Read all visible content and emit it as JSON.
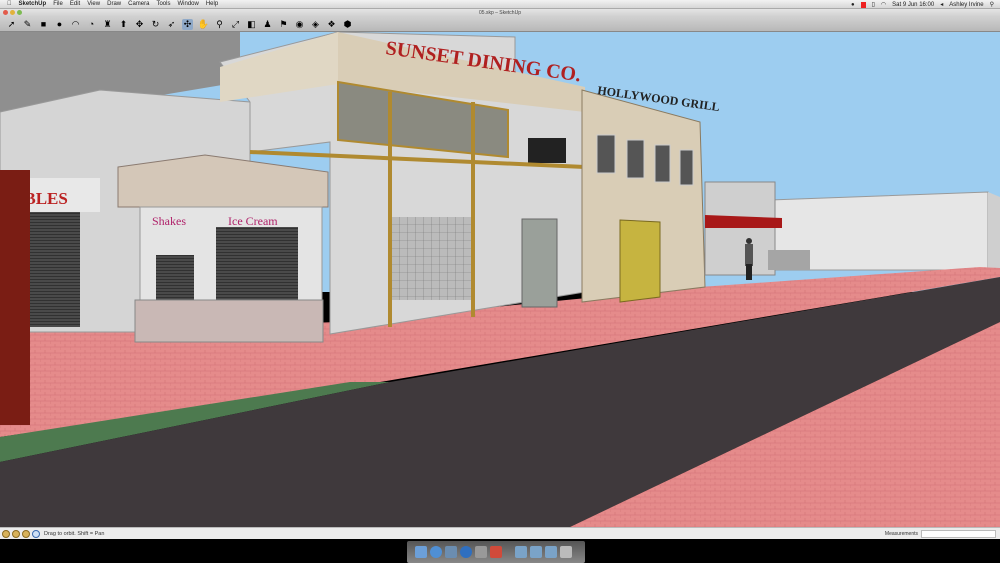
{
  "menubar": {
    "app": "SketchUp",
    "items": [
      "File",
      "Edit",
      "View",
      "Draw",
      "Camera",
      "Tools",
      "Window",
      "Help"
    ],
    "clock": "Sat 9 Jun  16:00",
    "user": "Ashley Irvine"
  },
  "window": {
    "title": "05.skp – SketchUp"
  },
  "toolbar": {
    "tools": [
      {
        "name": "select",
        "glyph": "➚"
      },
      {
        "name": "pencil",
        "glyph": "✎"
      },
      {
        "name": "rectangle",
        "glyph": "■"
      },
      {
        "name": "circle",
        "glyph": "●"
      },
      {
        "name": "arc",
        "glyph": "◠"
      },
      {
        "name": "eraser",
        "glyph": "◔"
      },
      {
        "name": "paint-bucket",
        "glyph": "♜"
      },
      {
        "name": "push-pull",
        "glyph": "⬆"
      },
      {
        "name": "move",
        "glyph": "✥"
      },
      {
        "name": "rotate",
        "glyph": "↻"
      },
      {
        "name": "follow-me",
        "glyph": "➶"
      },
      {
        "name": "orbit",
        "glyph": "✣",
        "active": true
      },
      {
        "name": "pan",
        "glyph": "✋"
      },
      {
        "name": "zoom",
        "glyph": "⚲"
      },
      {
        "name": "zoom-extents",
        "glyph": "⤢"
      },
      {
        "name": "previous",
        "glyph": "◧"
      },
      {
        "name": "position-camera",
        "glyph": "♟"
      },
      {
        "name": "walk",
        "glyph": "⚑"
      },
      {
        "name": "look-around",
        "glyph": "◉"
      },
      {
        "name": "section-plane",
        "glyph": "◈"
      },
      {
        "name": "components",
        "glyph": "❖"
      },
      {
        "name": "materials",
        "glyph": "⬢"
      }
    ]
  },
  "scene": {
    "sign_sunset": "SUNSET DINING CO.",
    "sign_hollywood": "HOLLYWOOD GRILL",
    "sign_shakes": "Shakes",
    "sign_icecream": "Ice Cream",
    "sign_tables": "TABLES"
  },
  "statusbar": {
    "hint": "Drag to orbit.  Shift = Pan",
    "measurements_label": "Measurements",
    "measurements_value": ""
  },
  "colors": {
    "sky": "#9dcdf0",
    "road": "#3f393c",
    "sidewalk": "#e5878a",
    "grass": "#4d7a4f"
  }
}
